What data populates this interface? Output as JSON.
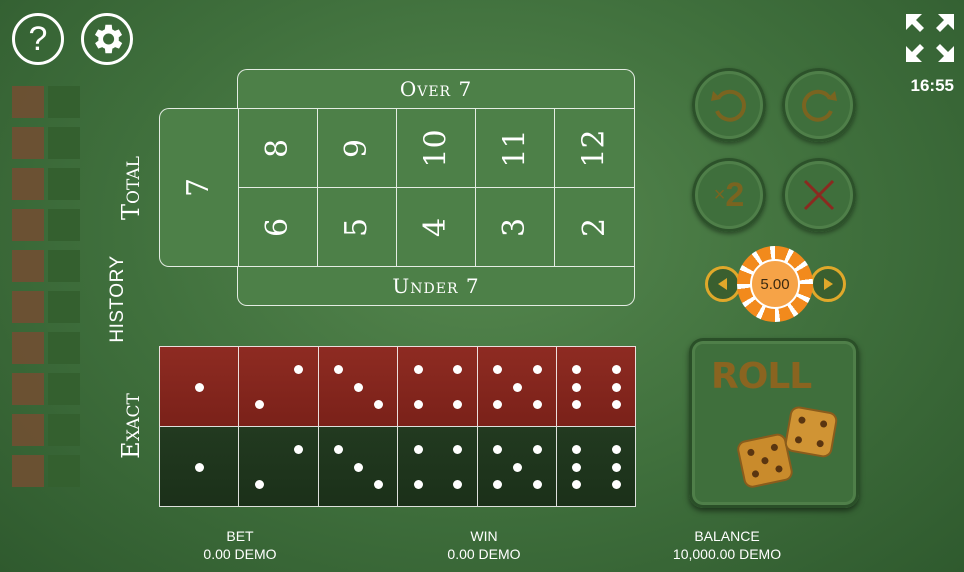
{
  "header": {
    "help_icon": "?",
    "clock": "16:55"
  },
  "history": {
    "label": "HISTORY"
  },
  "board": {
    "over_label": "Over 7",
    "under_label": "Under 7",
    "total_label": "Total",
    "exact_label": "Exact",
    "seven": "7",
    "top_row": [
      "8",
      "9",
      "10",
      "11",
      "12"
    ],
    "bottom_row": [
      "6",
      "5",
      "4",
      "3",
      "2"
    ]
  },
  "controls": {
    "double_label": "2",
    "double_prefix": "×",
    "chip_value": "5.00",
    "roll_label": "ROLL"
  },
  "footer": {
    "bet_label": "BET",
    "bet_value": "0.00 DEMO",
    "win_label": "WIN",
    "win_value": "0.00 DEMO",
    "balance_label": "BALANCE",
    "balance_value": "10,000.00 DEMO"
  },
  "colors": {
    "felt": "#4a7c45",
    "die_red": "#8e2b22",
    "die_dark": "#223a20",
    "chip": "#f28a1c",
    "gold": "#8a6420"
  }
}
